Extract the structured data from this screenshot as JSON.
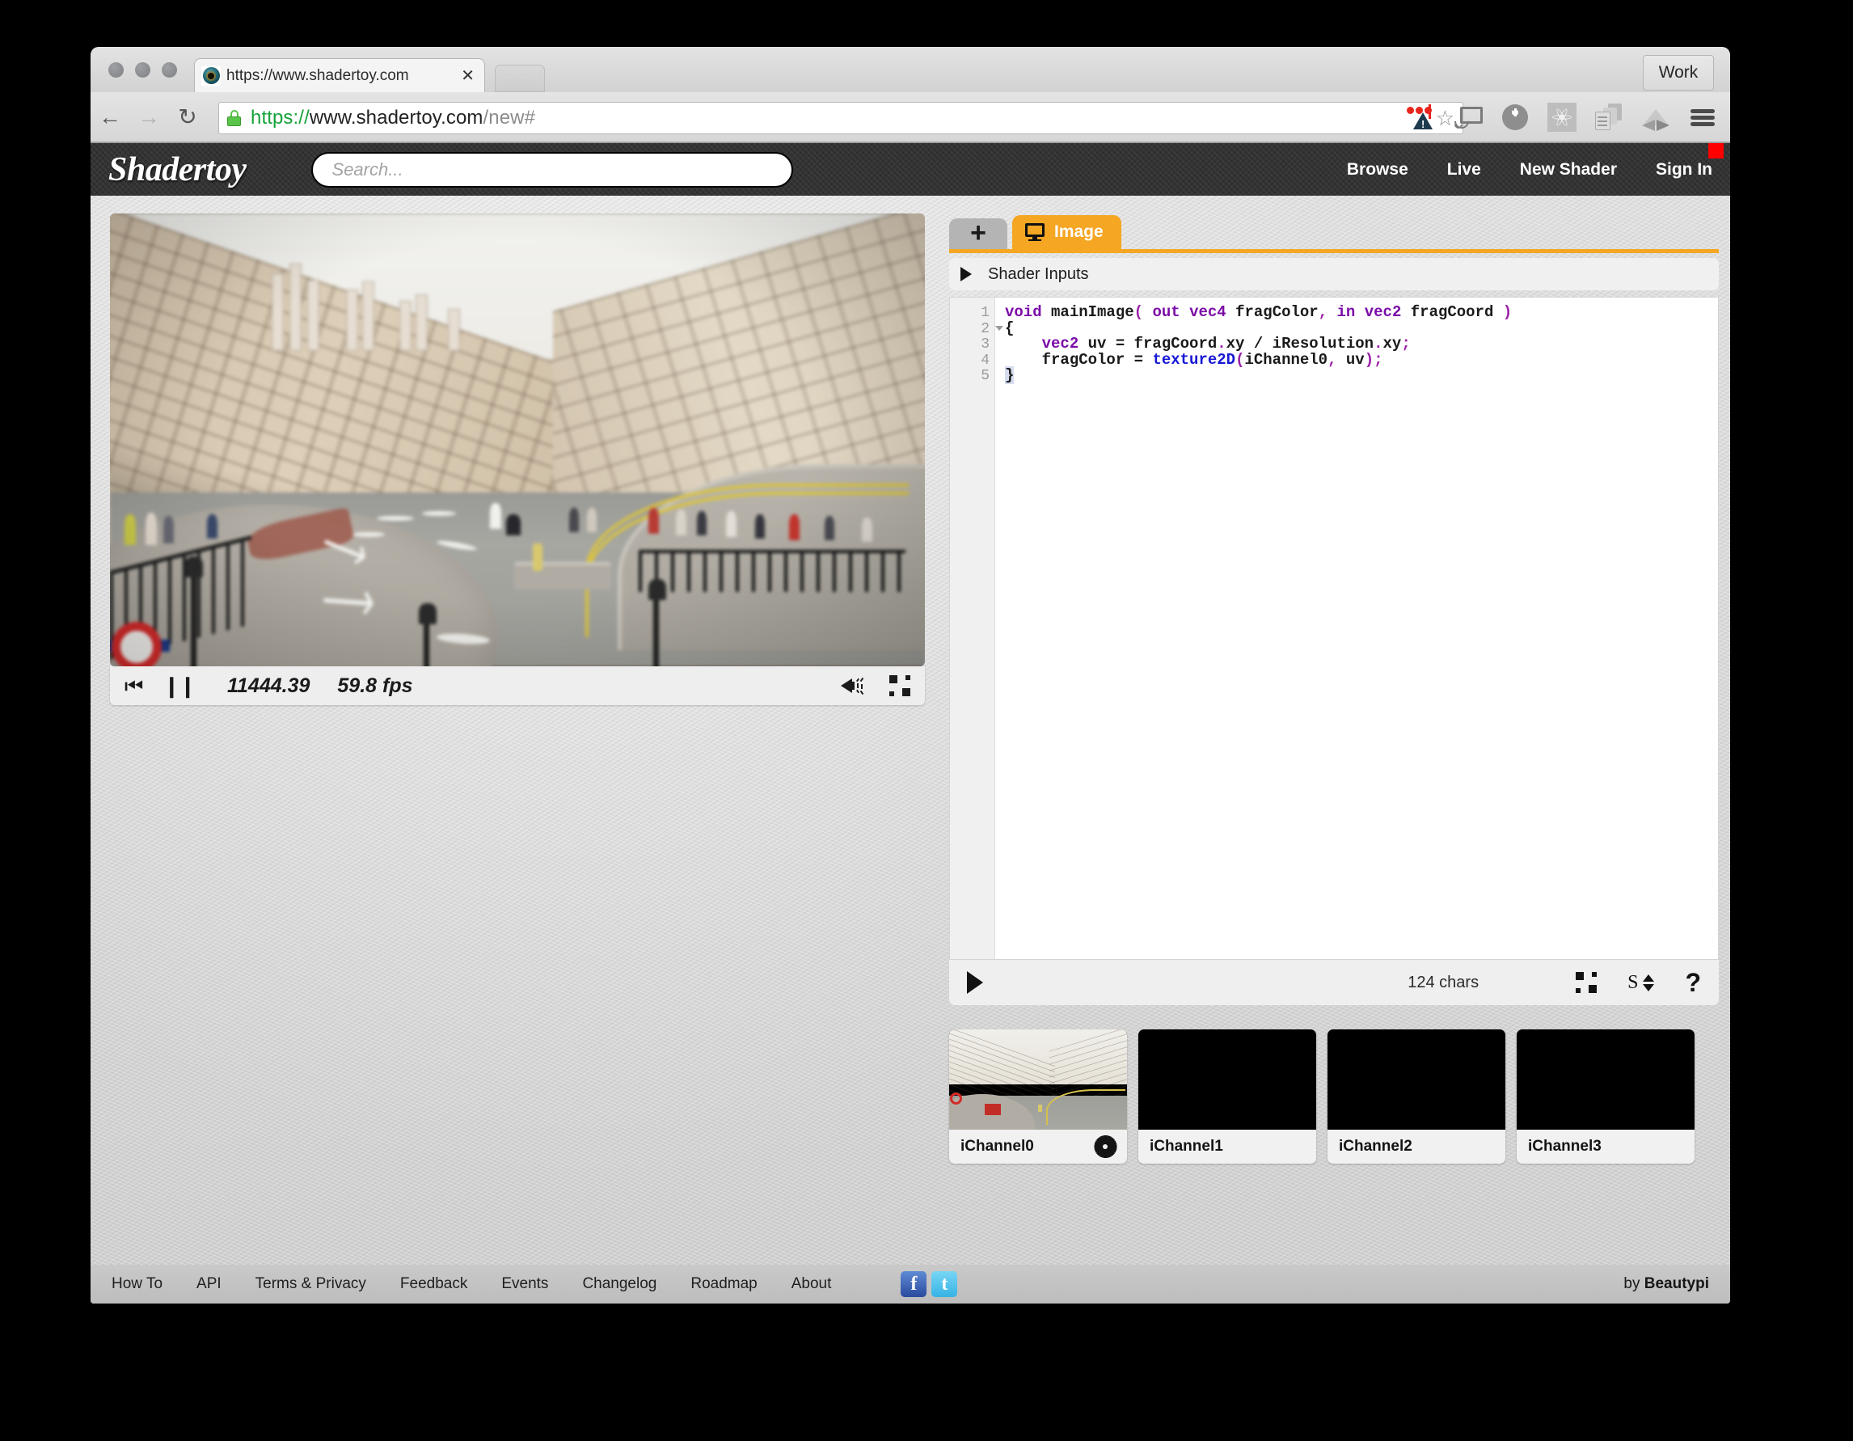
{
  "browser": {
    "tab_title": "https://www.shadertoy.com",
    "tab_close_label": "✕",
    "profile_button": "Work",
    "back_icon": "←",
    "forward_icon": "→",
    "reload_icon": "↻",
    "star_icon": "☆",
    "url": {
      "scheme": "https://",
      "host": "www.shadertoy.com",
      "path": "/new#"
    },
    "toolbar_icons": [
      "dots-warning-extension-icon",
      "cast-icon",
      "power-extension-icon",
      "react-devtools-icon",
      "copy-documents-extension-icon",
      "google-drive-icon",
      "chrome-menu-icon"
    ]
  },
  "header": {
    "logo": "Shadertoy",
    "search_placeholder": "Search...",
    "search_value": "",
    "nav": [
      {
        "label": "Browse"
      },
      {
        "label": "Live"
      },
      {
        "label": "New Shader"
      },
      {
        "label": "Sign In"
      }
    ],
    "rec_indicator_color": "#ff0000"
  },
  "preview": {
    "canvas_content": "london-regent-street-photo-texture",
    "reset_icon": "⏮",
    "pause_icon": "❙❙",
    "time": "11444.39",
    "fps": "59.8 fps",
    "sound_icon": "mute-speaker-icon",
    "fullscreen_icon": "fullscreen-icon"
  },
  "editor": {
    "add_tab_label": "+",
    "tabs": [
      {
        "label": "Image",
        "icon": "monitor-icon",
        "active": true
      }
    ],
    "shader_inputs_label": "Shader Inputs",
    "line_numbers": [
      "1",
      "2",
      "3",
      "4",
      "5"
    ],
    "char_count": "124 chars",
    "play_icon": "play-icon",
    "fullscreen_icon": "fullscreen-icon",
    "font_size_letter": "S",
    "help_icon": "?",
    "accent_color": "#f5a623",
    "code_lines": [
      [
        {
          "t": "void",
          "c": "kw"
        },
        {
          "t": " mainImage",
          "c": ""
        },
        {
          "t": "(",
          "c": "pn"
        },
        {
          "t": " ",
          "c": ""
        },
        {
          "t": "out",
          "c": "kw"
        },
        {
          "t": " ",
          "c": ""
        },
        {
          "t": "vec4",
          "c": "ty"
        },
        {
          "t": " fragColor",
          "c": ""
        },
        {
          "t": ",",
          "c": "pn"
        },
        {
          "t": " ",
          "c": ""
        },
        {
          "t": "in",
          "c": "kw"
        },
        {
          "t": " ",
          "c": ""
        },
        {
          "t": "vec2",
          "c": "ty"
        },
        {
          "t": " fragCoord ",
          "c": ""
        },
        {
          "t": ")",
          "c": "pn"
        }
      ],
      [
        {
          "t": "{",
          "c": ""
        }
      ],
      [
        {
          "t": "    ",
          "c": ""
        },
        {
          "t": "vec2",
          "c": "ty"
        },
        {
          "t": " uv = fragCoord",
          "c": ""
        },
        {
          "t": ".",
          "c": "pn"
        },
        {
          "t": "xy / iResolution",
          "c": ""
        },
        {
          "t": ".",
          "c": "pn"
        },
        {
          "t": "xy",
          "c": ""
        },
        {
          "t": ";",
          "c": "pn"
        }
      ],
      [
        {
          "t": "    fragColor = ",
          "c": ""
        },
        {
          "t": "texture2D",
          "c": "fn"
        },
        {
          "t": "(",
          "c": "pn"
        },
        {
          "t": "iChannel0",
          "c": ""
        },
        {
          "t": ",",
          "c": "pn"
        },
        {
          "t": " uv",
          "c": ""
        },
        {
          "t": ")",
          "c": "pn"
        },
        {
          "t": ";",
          "c": "pn"
        }
      ],
      [
        {
          "t": "}",
          "c": "sel"
        }
      ]
    ]
  },
  "channels": [
    {
      "label": "iChannel0",
      "has_texture": true,
      "has_gear": true
    },
    {
      "label": "iChannel1",
      "has_texture": false,
      "has_gear": false
    },
    {
      "label": "iChannel2",
      "has_texture": false,
      "has_gear": false
    },
    {
      "label": "iChannel3",
      "has_texture": false,
      "has_gear": false
    }
  ],
  "footer": {
    "links": [
      {
        "label": "How To"
      },
      {
        "label": "API"
      },
      {
        "label": "Terms & Privacy"
      },
      {
        "label": "Feedback"
      },
      {
        "label": "Events"
      },
      {
        "label": "Changelog"
      },
      {
        "label": "Roadmap"
      },
      {
        "label": "About"
      }
    ],
    "social": [
      {
        "name": "facebook-icon",
        "glyph": "f"
      },
      {
        "name": "twitter-icon",
        "glyph": "t"
      }
    ],
    "credit_prefix": "by ",
    "credit_name": "Beautypi"
  }
}
